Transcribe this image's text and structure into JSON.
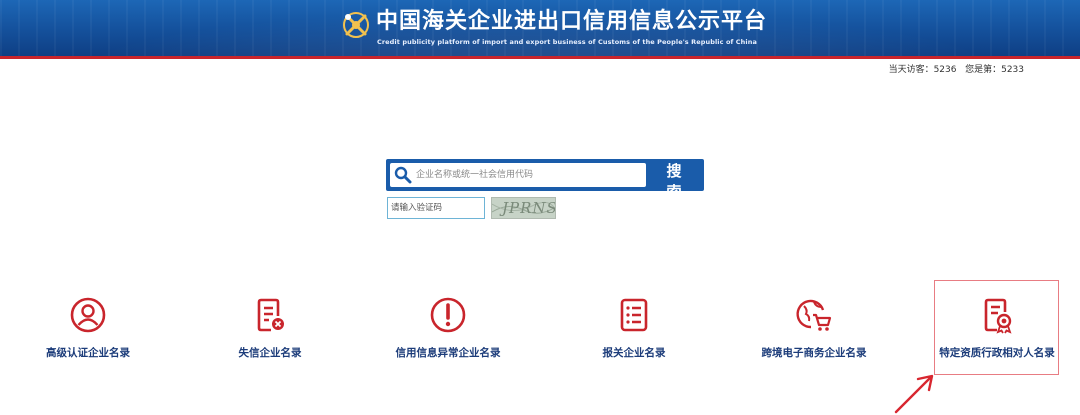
{
  "header": {
    "title": "中国海关企业进出口信用信息公示平台",
    "subtitle": "Credit publicity platform of import and export business of Customs of the People's Republic of China"
  },
  "visitors": {
    "today_label": "当天访客：",
    "today_count": "5236",
    "you_label": "您是第：",
    "you_count": "5233"
  },
  "search": {
    "placeholder": "企业名称或统一社会信用代码",
    "button_label": "搜 索",
    "captcha_placeholder": "请输入验证码",
    "captcha_text": "JPRNS"
  },
  "categories": [
    {
      "label": "高级认证企业名录",
      "icon": "person-icon"
    },
    {
      "label": "失信企业名录",
      "icon": "document-x-icon"
    },
    {
      "label": "信用信息异常企业名录",
      "icon": "exclamation-icon"
    },
    {
      "label": "报关企业名录",
      "icon": "list-icon"
    },
    {
      "label": "跨境电子商务企业名录",
      "icon": "globe-cart-icon"
    },
    {
      "label": "特定资质行政相对人名录",
      "icon": "certificate-icon"
    }
  ],
  "colors": {
    "header_blue": "#14509b",
    "accent_red": "#c9252c",
    "label_navy": "#1c3c7a"
  }
}
